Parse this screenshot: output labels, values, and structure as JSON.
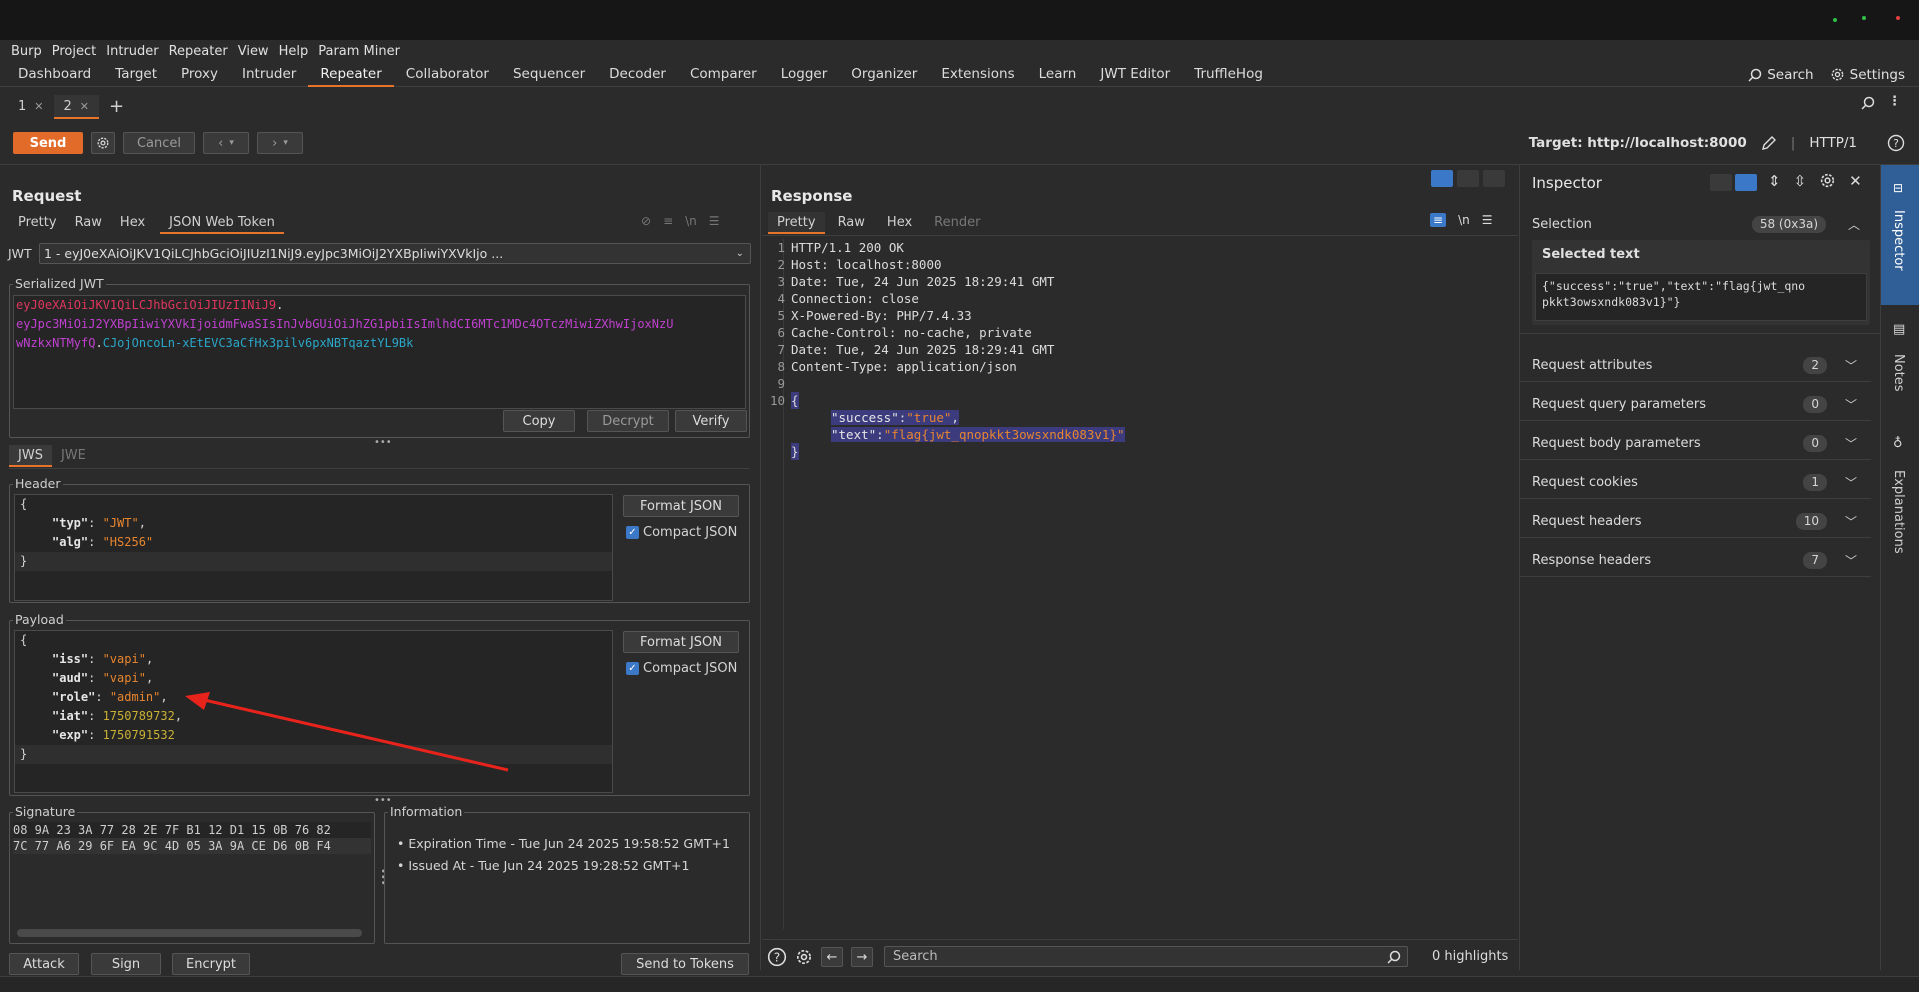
{
  "menu": [
    "Burp",
    "Project",
    "Intruder",
    "Repeater",
    "View",
    "Help",
    "Param Miner"
  ],
  "main_tabs": [
    "Dashboard",
    "Target",
    "Proxy",
    "Intruder",
    "Repeater",
    "Collaborator",
    "Sequencer",
    "Decoder",
    "Comparer",
    "Logger",
    "Organizer",
    "Extensions",
    "Learn",
    "JWT Editor",
    "TruffleHog"
  ],
  "active_main_tab": "Repeater",
  "top_right": {
    "search": "Search",
    "settings": "Settings"
  },
  "repeater_tabs": [
    {
      "label": "1"
    },
    {
      "label": "2"
    }
  ],
  "toolbar": {
    "send": "Send",
    "cancel": "Cancel",
    "target": "Target: http://localhost:8000",
    "http_version": "HTTP/1"
  },
  "request": {
    "title": "Request",
    "tabs": [
      "Pretty",
      "Raw",
      "Hex",
      "JSON Web Token"
    ],
    "jwt_label": "JWT",
    "jwt_select": "1 - eyJ0eXAiOiJKV1QiLCJhbGciOiJIUzI1NiJ9.eyJpc3MiOiJ2YXBpIiwiYXVkIjo ...",
    "serialized_label": "Serialized JWT",
    "serialized_header": "eyJ0eXAiOiJKV1QiLCJhbGciOiJIUzI1NiJ9",
    "serialized_payload_1": "eyJpc3MiOiJ2YXBpIiwiYXVkIjoidmFwaSIsInJvbGUiOiJhZG1pbiIsImlhdCI6MTc1MDc4OTczMiwiZXhwIjoxNzU",
    "serialized_payload_2": "wNzkxNTMyfQ",
    "serialized_sig": "CJojOncoLn-xEtEVC3aCfHx3pilv6pxNBTqaztYL9Bk",
    "copy": "Copy",
    "decrypt": "Decrypt",
    "verify": "Verify",
    "jws": "JWS",
    "jwe": "JWE",
    "header_label": "Header",
    "header_typ_key": "\"typ\"",
    "header_typ_val": "\"JWT\"",
    "header_alg_key": "\"alg\"",
    "header_alg_val": "\"HS256\"",
    "payload_label": "Payload",
    "payload_iss_key": "\"iss\"",
    "payload_iss_val": "\"vapi\"",
    "payload_aud_key": "\"aud\"",
    "payload_aud_val": "\"vapi\"",
    "payload_role_key": "\"role\"",
    "payload_role_val": "\"admin\"",
    "payload_iat_key": "\"iat\"",
    "payload_iat_val": "1750789732",
    "payload_exp_key": "\"exp\"",
    "payload_exp_val": "1750791532",
    "format_json": "Format JSON",
    "compact_json": "Compact JSON",
    "signature_label": "Signature",
    "sig_row1": "08 9A 23 3A 77 28 2E 7F B1 12 D1 15 0B 76 82",
    "sig_row2": "7C 77 A6 29 6F EA 9C 4D 05 3A 9A CE D6 0B F4",
    "info_label": "Information",
    "info_1": "• Expiration Time - Tue Jun 24 2025 19:58:52 GMT+1",
    "info_2": "• Issued At - Tue Jun 24 2025 19:28:52 GMT+1",
    "attack": "Attack",
    "sign": "Sign",
    "encrypt": "Encrypt",
    "send_to_tokens": "Send to Tokens"
  },
  "response": {
    "title": "Response",
    "tabs": [
      "Pretty",
      "Raw",
      "Hex",
      "Render"
    ],
    "lines": [
      "HTTP/1.1 200 OK",
      "Host: localhost:8000",
      "Date: Tue, 24 Jun 2025 18:29:41 GMT",
      "Connection: close",
      "X-Powered-By: PHP/7.4.33",
      "Cache-Control: no-cache, private",
      "Date: Tue, 24 Jun 2025 18:29:41 GMT",
      "Content-Type: application/json",
      "",
      ""
    ],
    "body_open": "{",
    "body_success_key": "\"success\"",
    "body_success_val": "\"true\"",
    "body_text_key": "\"text\"",
    "body_text_val": "\"flag{jwt_qnopkkt3owsxndk083v1}\"",
    "body_close": "}",
    "search_placeholder": "Search",
    "highlights": "0 highlights"
  },
  "inspector": {
    "title": "Inspector",
    "selection": "Selection",
    "selection_count": "58 (0x3a)",
    "selected_text_label": "Selected text",
    "selected_text_1": "{\"success\":\"true\",\"text\":\"flag{jwt_qno",
    "selected_text_2": "pkkt3owsxndk083v1}\"}",
    "rows": [
      {
        "label": "Request attributes",
        "count": "2"
      },
      {
        "label": "Request query parameters",
        "count": "0"
      },
      {
        "label": "Request body parameters",
        "count": "0"
      },
      {
        "label": "Request cookies",
        "count": "1"
      },
      {
        "label": "Request headers",
        "count": "10"
      },
      {
        "label": "Response headers",
        "count": "7"
      }
    ]
  },
  "side_tabs": [
    "Inspector",
    "Notes",
    "Explanations"
  ],
  "colors": {
    "accent": "#e8742b",
    "send": "#e36b2a",
    "jwt_header": "#e0365d",
    "jwt_payload": "#c040d0",
    "jwt_sig": "#2aa7c9",
    "selection": "#3b3b7d",
    "arrow": "#e8231c"
  },
  "icons": [
    "search-icon",
    "gear-icon",
    "plus-icon",
    "pencil-icon",
    "help-icon",
    "close-icon",
    "chevron-down-icon",
    "arrow-left-icon",
    "arrow-right-icon",
    "menu-icon"
  ]
}
